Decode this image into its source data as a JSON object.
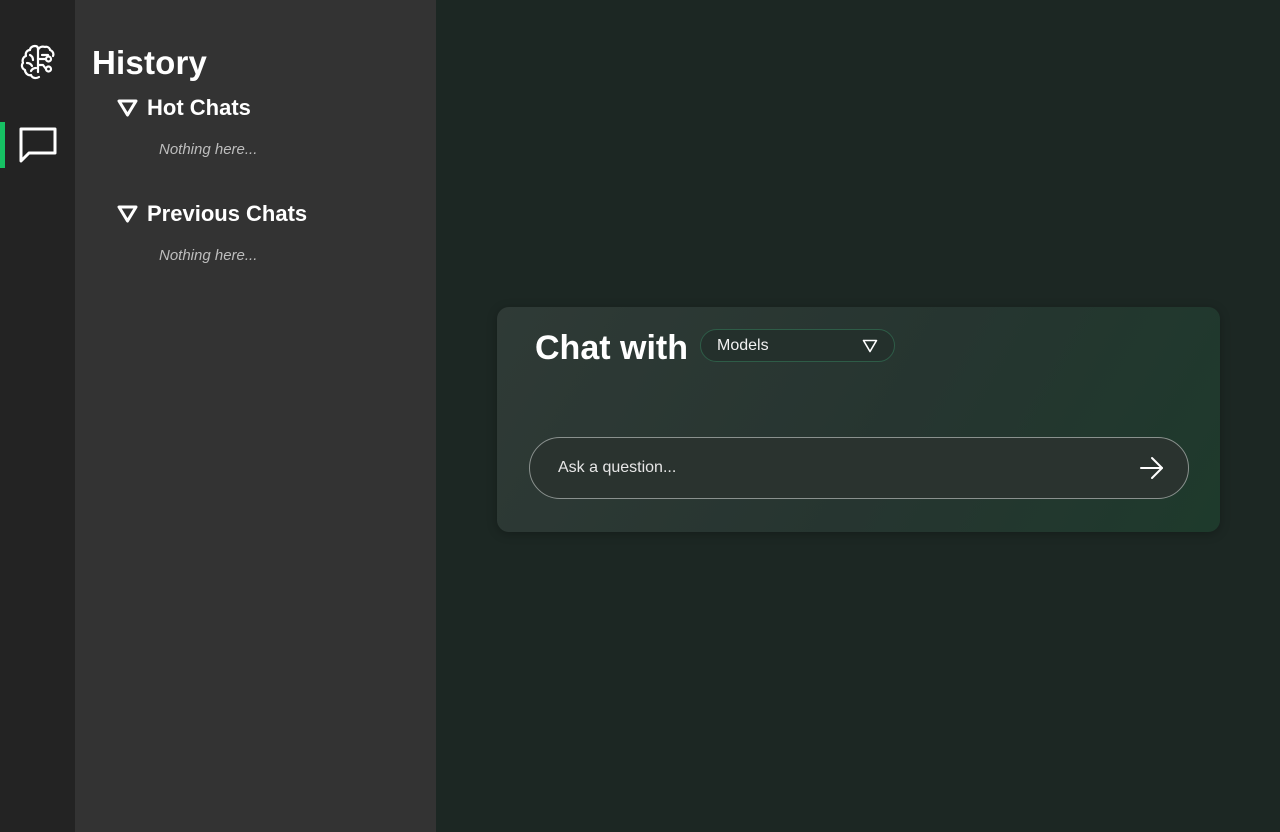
{
  "rail": {
    "items": [
      {
        "icon": "brain-icon"
      },
      {
        "icon": "chat-bubble-icon",
        "active": true
      }
    ]
  },
  "history": {
    "title": "History",
    "sections": [
      {
        "label": "Hot Chats",
        "empty_text": "Nothing here..."
      },
      {
        "label": "Previous Chats",
        "empty_text": "Nothing here..."
      }
    ]
  },
  "chat": {
    "title": "Chat with",
    "model_select": {
      "value": "Models"
    },
    "input": {
      "placeholder": "Ask a question...",
      "value": ""
    }
  },
  "colors": {
    "accent": "#16c063",
    "rail_bg": "#232323",
    "sidebar_bg": "#333333",
    "main_bg": "#1c2723"
  }
}
